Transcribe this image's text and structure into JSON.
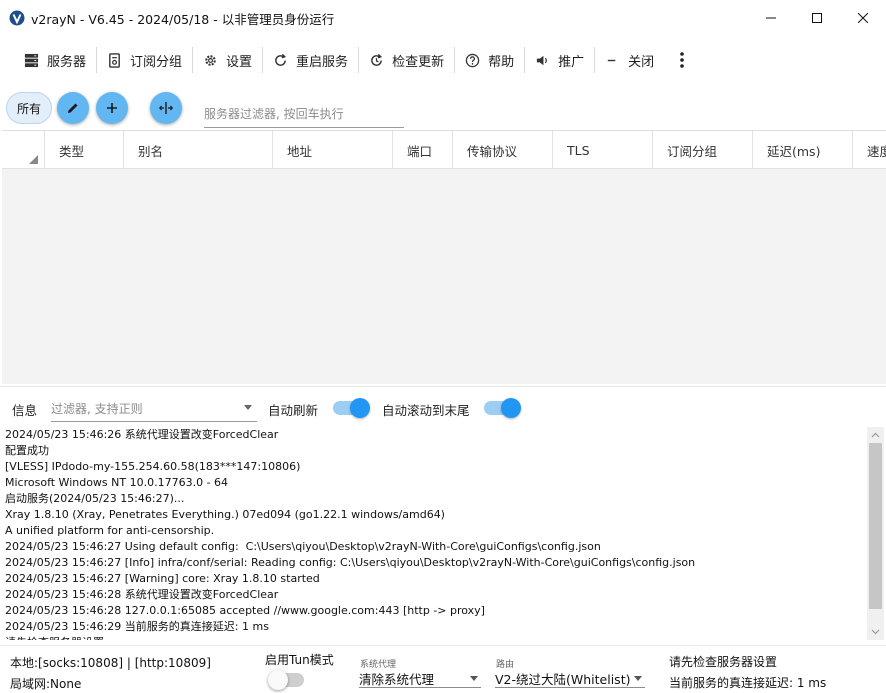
{
  "window": {
    "title": "v2rayN - V6.45 - 2024/05/18 - 以非管理员身份运行",
    "icon": "v2rayn-logo-icon"
  },
  "toolbar": {
    "servers": "服务器",
    "subscription_group": "订阅分组",
    "settings": "设置",
    "restart_service": "重启服务",
    "check_update": "检查更新",
    "help": "帮助",
    "promotion": "推广",
    "close": "关闭"
  },
  "filter_row": {
    "all_chip": "所有",
    "server_filter_placeholder": "服务器过滤器, 按回车执行"
  },
  "grid": {
    "columns": [
      "类型",
      "别名",
      "地址",
      "端口",
      "传输协议",
      "TLS",
      "订阅分组",
      "延迟(ms)",
      "速度"
    ]
  },
  "log_panel": {
    "info_label": "信息",
    "log_filter_placeholder": "过滤器, 支持正则",
    "auto_refresh_label": "自动刷新",
    "auto_refresh_on": true,
    "auto_scroll_label": "自动滚动到末尾",
    "auto_scroll_on": true,
    "lines": [
      "2024/05/23 15:46:26 系统代理设置改变ForcedClear",
      "配置成功",
      "[VLESS] IPdodo-my-155.254.60.58(183***147:10806)",
      "Microsoft Windows NT 10.0.17763.0 - 64",
      "启动服务(2024/05/23 15:46:27)...",
      "Xray 1.8.10 (Xray, Penetrates Everything.) 07ed094 (go1.22.1 windows/amd64)",
      "A unified platform for anti-censorship.",
      "2024/05/23 15:46:27 Using default config:  C:\\Users\\qiyou\\Desktop\\v2rayN-With-Core\\guiConfigs\\config.json",
      "2024/05/23 15:46:27 [Info] infra/conf/serial: Reading config: C:\\Users\\qiyou\\Desktop\\v2rayN-With-Core\\guiConfigs\\config.json",
      "2024/05/23 15:46:27 [Warning] core: Xray 1.8.10 started",
      "2024/05/23 15:46:28 系统代理设置改变ForcedClear",
      "2024/05/23 15:46:28 127.0.0.1:65085 accepted //www.google.com:443 [http -> proxy]",
      "2024/05/23 15:46:29 当前服务的真连接延迟: 1 ms",
      "请先检查服务器设置"
    ]
  },
  "statusbar": {
    "local_ports": "本地:[socks:10808] | [http:10809]",
    "lan": "局域网:None",
    "tun_label": "启用Tun模式",
    "tun_on": false,
    "sysproxy_caption": "系统代理",
    "sysproxy_value": "清除系统代理",
    "routing_caption": "路由",
    "routing_value": "V2-绕过大陆(Whitelist)",
    "status_line1": "请先检查服务器设置",
    "status_line2": "当前服务的真连接延迟: 1 ms"
  },
  "colors": {
    "accent": "#2196f3",
    "fab": "#62b7f3"
  }
}
